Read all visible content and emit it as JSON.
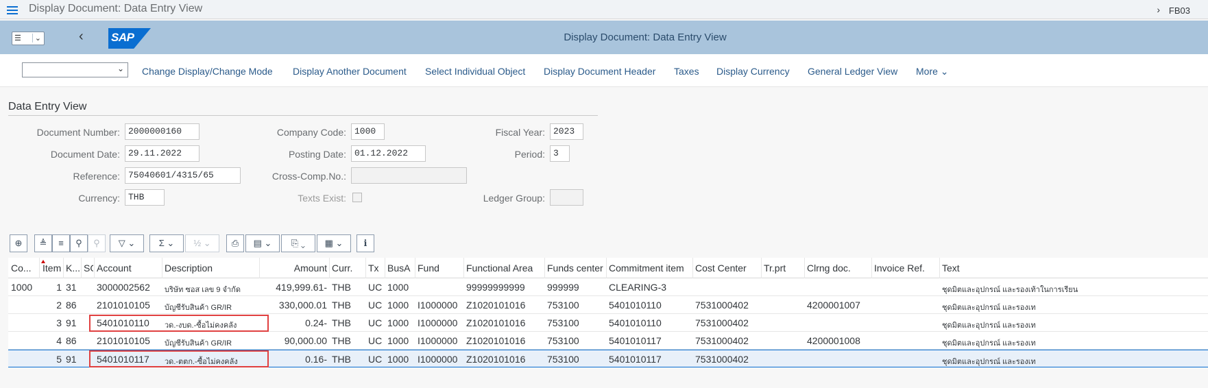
{
  "window": {
    "title": "Display Document: Data Entry View",
    "tcode": "FB03"
  },
  "shell": {
    "title": "Display Document: Data Entry View",
    "logo": "SAP"
  },
  "toolbar": {
    "items": [
      "Change Display/Change Mode",
      "Display Another Document",
      "Select Individual Object",
      "Display Document Header",
      "Taxes",
      "Display Currency",
      "General Ledger View",
      "More"
    ]
  },
  "header": {
    "section_title": "Data Entry View",
    "document_number_label": "Document Number:",
    "document_number": "2000000160",
    "document_date_label": "Document Date:",
    "document_date": "29.11.2022",
    "reference_label": "Reference:",
    "reference": "75040601/4315/65",
    "currency_label": "Currency:",
    "currency": "THB",
    "company_code_label": "Company Code:",
    "company_code": "1000",
    "posting_date_label": "Posting Date:",
    "posting_date": "01.12.2022",
    "cross_comp_label": "Cross-Comp.No.:",
    "cross_comp": "",
    "texts_exist_label": "Texts Exist:",
    "fiscal_year_label": "Fiscal Year:",
    "fiscal_year": "2023",
    "period_label": "Period:",
    "period": "3",
    "ledger_group_label": "Ledger Group:",
    "ledger_group": ""
  },
  "table": {
    "columns": [
      "Co...",
      "Item",
      "K...",
      "SG",
      "Account",
      "Description",
      "Amount",
      "Curr.",
      "Tx",
      "BusA",
      "Fund",
      "Functional Area",
      "Funds center",
      "Commitment item",
      "Cost Center",
      "Tr.prt",
      "Clrng doc.",
      "Invoice Ref.",
      "Text"
    ],
    "rows": [
      [
        "1000",
        "1",
        "31",
        "",
        "3000002562",
        "บริษัท ซอส เลข 9 จำกัด",
        "419,999.61-",
        "THB",
        "UC",
        "1000",
        "",
        "99999999999",
        "999999",
        "CLEARING-3",
        "",
        "",
        "",
        "",
        "ชุดมิตและอุปกรณ์ และรองเท้าในการเรียน"
      ],
      [
        "",
        "2",
        "86",
        "",
        "2101010105",
        "บัญชีรับสินค้า GR/IR",
        "330,000.01",
        "THB",
        "UC",
        "1000",
        "I1000000",
        "Z1020101016",
        "753100",
        "5401010110",
        "7531000402",
        "",
        "4200001007",
        "",
        "ชุดมิตและอุปกรณ์ และรองเท"
      ],
      [
        "",
        "3",
        "91",
        "",
        "5401010110",
        "วด.-งบด.-ซื้อไม่คงคลัง",
        "0.24-",
        "THB",
        "UC",
        "1000",
        "I1000000",
        "Z1020101016",
        "753100",
        "5401010110",
        "7531000402",
        "",
        "",
        "",
        "ชุดมิตและอุปกรณ์ และรองเท"
      ],
      [
        "",
        "4",
        "86",
        "",
        "2101010105",
        "บัญชีรับสินค้า GR/IR",
        "90,000.00",
        "THB",
        "UC",
        "1000",
        "I1000000",
        "Z1020101016",
        "753100",
        "5401010117",
        "7531000402",
        "",
        "4200001008",
        "",
        "ชุดมิตและอุปกรณ์ และรองเท"
      ],
      [
        "",
        "5",
        "91",
        "",
        "5401010117",
        "วด.-ตตก.-ซื้อไม่คงคลัง",
        "0.16-",
        "THB",
        "UC",
        "1000",
        "I1000000",
        "Z1020101016",
        "753100",
        "5401010117",
        "7531000402",
        "",
        "",
        "",
        "ชุดมิตและอุปกรณ์ และรองเท"
      ]
    ]
  },
  "colors": {
    "shell": "#a9c4dc",
    "accent": "#0a6ed1",
    "highlight": "#e04040"
  }
}
